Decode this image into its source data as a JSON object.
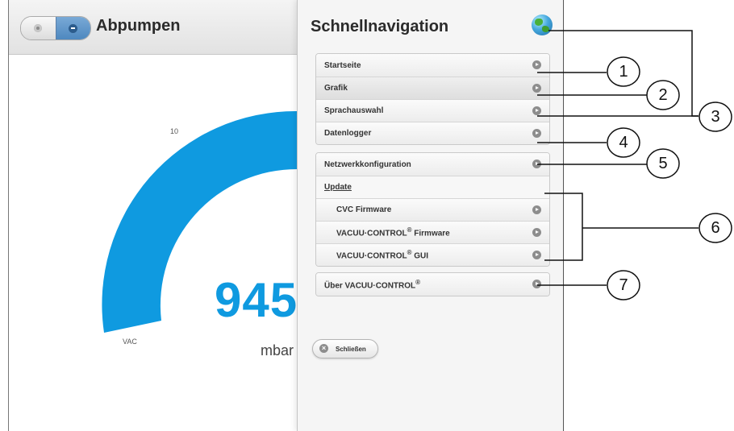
{
  "app": {
    "title": "Abpumpen",
    "gauge": {
      "tick_label": "10",
      "value": "945",
      "unit": "mbar",
      "low_label": "VAC",
      "color": "#0f9ae0"
    }
  },
  "panel": {
    "title": "Schnellnavigation",
    "globe_icon": "globe-icon",
    "group1": [
      "Startseite",
      "Grafik",
      "Sprachauswahl",
      "Datenlogger"
    ],
    "group2": {
      "network": "Netzwerkkonfiguration",
      "update_header": "Update",
      "cvc_firmware": "CVC Firmware",
      "vc_firmware_prefix": "VACUU·CONTROL",
      "vc_firmware_suffix": " Firmware",
      "vc_gui_prefix": "VACUU·CONTROL",
      "vc_gui_suffix": " GUI",
      "registered": "®"
    },
    "about_prefix": "Über VACUU·CONTROL",
    "registered": "®",
    "close_label": "Schließen"
  },
  "callouts": [
    "1",
    "2",
    "3",
    "4",
    "5",
    "6",
    "7"
  ]
}
